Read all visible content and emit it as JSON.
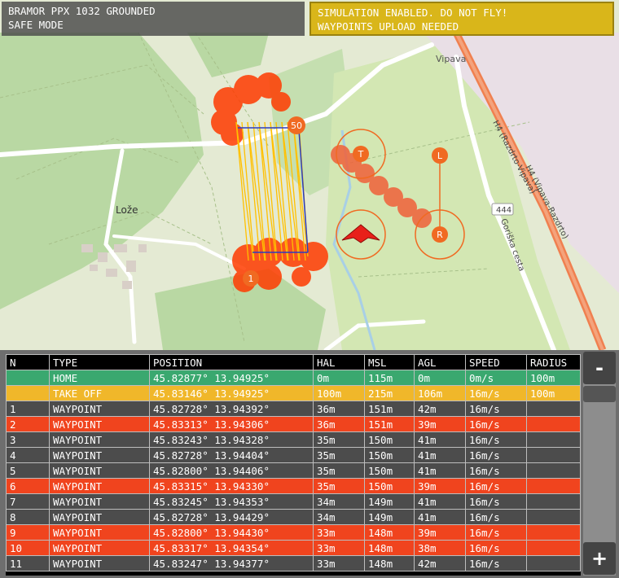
{
  "status": {
    "vehicle": "BRAMOR PPX 1032 GROUNDED",
    "mode": "SAFE MODE",
    "warning1": "SIMULATION ENABLED. DO NOT FLY!",
    "warning2": "WAYPOINTS UPLOAD NEEDED"
  },
  "map": {
    "places": [
      "Lože",
      "Vipava"
    ],
    "roads": [
      "H4 (Razdrto-Vipava)",
      "H4 (Vipava-Razdrto)",
      "Goriška cesta"
    ],
    "road_number": "444",
    "markers": {
      "start": "1",
      "end": "50",
      "takeoff": "T",
      "landing": "L",
      "rally": "R"
    },
    "colors": {
      "path": "#ff3b00",
      "lines": "#ffc000",
      "route": "#ff6a00"
    }
  },
  "table": {
    "columns": [
      "N",
      "TYPE",
      "POSITION",
      "HAL",
      "MSL",
      "AGL",
      "SPEED",
      "RADIUS"
    ],
    "rows": [
      {
        "n": "",
        "type": "HOME",
        "pos": "45.82877° 13.94925°",
        "hal": "0m",
        "msl": "115m",
        "agl": "0m",
        "speed": "0m/s",
        "radius": "100m",
        "kind": "home"
      },
      {
        "n": "",
        "type": "TAKE OFF",
        "pos": "45.83146° 13.94925°",
        "hal": "100m",
        "msl": "215m",
        "agl": "106m",
        "speed": "16m/s",
        "radius": "100m",
        "kind": "takeoff"
      },
      {
        "n": "1",
        "type": "WAYPOINT",
        "pos": "45.82728° 13.94392°",
        "hal": "36m",
        "msl": "151m",
        "agl": "42m",
        "speed": "16m/s",
        "radius": "",
        "kind": "wp"
      },
      {
        "n": "2",
        "type": "WAYPOINT",
        "pos": "45.83313° 13.94306°",
        "hal": "36m",
        "msl": "151m",
        "agl": "39m",
        "speed": "16m/s",
        "radius": "",
        "kind": "wp hl"
      },
      {
        "n": "3",
        "type": "WAYPOINT",
        "pos": "45.83243° 13.94328°",
        "hal": "35m",
        "msl": "150m",
        "agl": "41m",
        "speed": "16m/s",
        "radius": "",
        "kind": "wp"
      },
      {
        "n": "4",
        "type": "WAYPOINT",
        "pos": "45.82728° 13.94404°",
        "hal": "35m",
        "msl": "150m",
        "agl": "41m",
        "speed": "16m/s",
        "radius": "",
        "kind": "wp"
      },
      {
        "n": "5",
        "type": "WAYPOINT",
        "pos": "45.82800° 13.94406°",
        "hal": "35m",
        "msl": "150m",
        "agl": "41m",
        "speed": "16m/s",
        "radius": "",
        "kind": "wp"
      },
      {
        "n": "6",
        "type": "WAYPOINT",
        "pos": "45.83315° 13.94330°",
        "hal": "35m",
        "msl": "150m",
        "agl": "39m",
        "speed": "16m/s",
        "radius": "",
        "kind": "wp hl"
      },
      {
        "n": "7",
        "type": "WAYPOINT",
        "pos": "45.83245° 13.94353°",
        "hal": "34m",
        "msl": "149m",
        "agl": "41m",
        "speed": "16m/s",
        "radius": "",
        "kind": "wp"
      },
      {
        "n": "8",
        "type": "WAYPOINT",
        "pos": "45.82728° 13.94429°",
        "hal": "34m",
        "msl": "149m",
        "agl": "41m",
        "speed": "16m/s",
        "radius": "",
        "kind": "wp"
      },
      {
        "n": "9",
        "type": "WAYPOINT",
        "pos": "45.82800° 13.94430°",
        "hal": "33m",
        "msl": "148m",
        "agl": "39m",
        "speed": "16m/s",
        "radius": "",
        "kind": "wp hl"
      },
      {
        "n": "10",
        "type": "WAYPOINT",
        "pos": "45.83317° 13.94354°",
        "hal": "33m",
        "msl": "148m",
        "agl": "38m",
        "speed": "16m/s",
        "radius": "",
        "kind": "wp hl"
      },
      {
        "n": "11",
        "type": "WAYPOINT",
        "pos": "45.83247° 13.94377°",
        "hal": "33m",
        "msl": "148m",
        "agl": "42m",
        "speed": "16m/s",
        "radius": "",
        "kind": "wp"
      }
    ]
  },
  "buttons": {
    "minus": "-",
    "plus": "+"
  }
}
